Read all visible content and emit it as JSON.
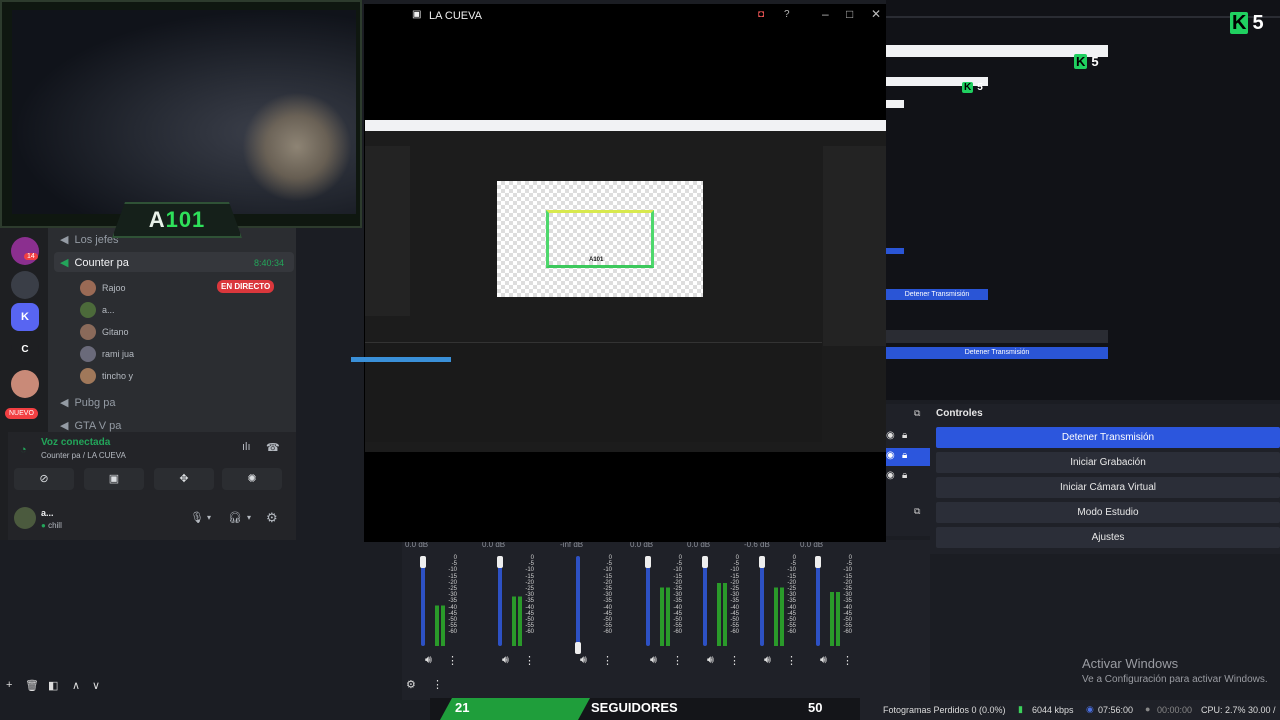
{
  "webcam": {
    "overlay_text_prefix": "A",
    "overlay_text_accent": "101"
  },
  "stream_window": {
    "title": "LA CUEVA",
    "overlay_label": "A101"
  },
  "discord": {
    "servers": [
      {
        "name": "server-1",
        "badge": "14"
      },
      {
        "name": "server-2",
        "badge": ""
      },
      {
        "name": "kick-server",
        "letter": "K"
      },
      {
        "name": "c-server",
        "letter": "C"
      },
      {
        "name": "server-5",
        "badge": ""
      },
      {
        "name": "new-server",
        "letter": "NUEVO"
      }
    ],
    "channels": [
      {
        "label": "Los jefes"
      },
      {
        "label": "Counter pa",
        "time": "8:40:34"
      },
      {
        "label": "Pubg pa"
      },
      {
        "label": "GTA V pa"
      }
    ],
    "users": [
      {
        "name": "Rajoo",
        "badge": "EN DIRECTO"
      },
      {
        "name": "a..."
      },
      {
        "name": "Gitano"
      },
      {
        "name": "rami jua"
      },
      {
        "name": "tincho y"
      }
    ],
    "voice": {
      "status": "Voz conectada",
      "location": "Counter pa / LA CUEVA"
    },
    "me": {
      "name": "a...",
      "status": "chill"
    }
  },
  "obs": {
    "controls_title": "Controles",
    "controls": [
      {
        "label": "Detener Transmisión",
        "active": true
      },
      {
        "label": "Iniciar Grabación"
      },
      {
        "label": "Iniciar Cámara Virtual"
      },
      {
        "label": "Modo Estudio"
      },
      {
        "label": "Ajustes"
      }
    ],
    "preview_buttons": [
      "Detener Transmisión",
      "Detener Transmisión"
    ],
    "preview_counts": [
      "5",
      "5",
      "5"
    ],
    "mixer": [
      {
        "db": "0.0 dB",
        "level": 0.45
      },
      {
        "db": "0.0 dB",
        "level": 0.55
      },
      {
        "db": "-inf dB",
        "level": 0.0
      },
      {
        "db": "0.0 dB",
        "level": 0.65
      },
      {
        "db": "0.0 dB",
        "level": 0.7
      },
      {
        "db": "-0.6 dB",
        "level": 0.65
      },
      {
        "db": "0.0 dB",
        "level": 0.6
      }
    ],
    "scale_labels": [
      "0",
      "-5",
      "-10",
      "-15",
      "-20",
      "-25",
      "-30",
      "-35",
      "-40",
      "-45",
      "-50",
      "-55",
      "-60"
    ],
    "status": {
      "dropped": "Fotogramas Perdidos 0 (0.0%)",
      "bitrate": "6044 kbps",
      "live_time": "07:56:00",
      "rec_time": "00:00:00",
      "cpu": "CPU: 2.7%",
      "fps": "30.00 /"
    }
  },
  "followers": {
    "current": "21",
    "label": "SEGUIDORES",
    "goal": "50"
  },
  "windows_watermark": {
    "title": "Activar Windows",
    "subtitle": "Ve a Configuración para activar Windows."
  }
}
